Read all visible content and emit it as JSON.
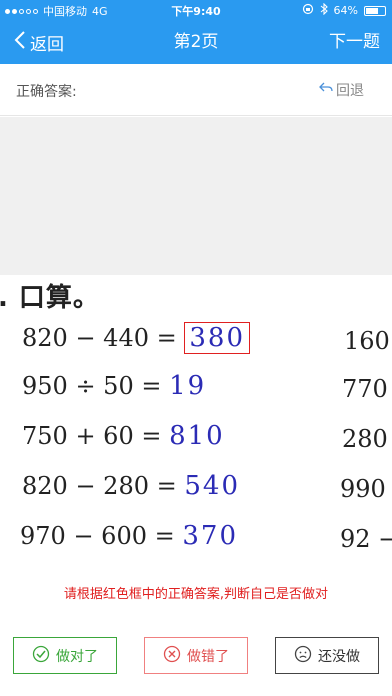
{
  "status_bar": {
    "carrier": "中国移动",
    "network": "4G",
    "time": "下午9:40",
    "battery": "64%",
    "battery_level": 0.64,
    "signal_dots_filled": 2,
    "signal_dots_total": 5
  },
  "nav": {
    "back_label": "返回",
    "title": "第2页",
    "next_label": "下一题"
  },
  "answer": {
    "label": "正确答案:",
    "undo_label": "回退"
  },
  "worksheet": {
    "heading": ". 口算。",
    "equations": [
      {
        "expr": "820 − 440 =",
        "answer": "380",
        "boxed": true
      },
      {
        "expr": "950 ÷ 50 =",
        "answer": "19",
        "boxed": false
      },
      {
        "expr": "750 + 60 =",
        "answer": "810",
        "boxed": false
      },
      {
        "expr": "820 − 280 =",
        "answer": "540",
        "boxed": false
      },
      {
        "expr": "970 − 600 =",
        "answer": "370",
        "boxed": false
      }
    ],
    "right_column": [
      "160",
      "770",
      "280",
      "990",
      "92 −"
    ]
  },
  "instruction": "请根据红色框中的正确答案,判断自己是否做对",
  "buttons": {
    "correct": "做对了",
    "wrong": "做错了",
    "skip": "还没做"
  },
  "colors": {
    "primary": "#2a9af0",
    "correct": "#3aa63a",
    "wrong": "#e05050",
    "answer_ink": "#2b2bb5",
    "highlight_box": "#e02020"
  }
}
